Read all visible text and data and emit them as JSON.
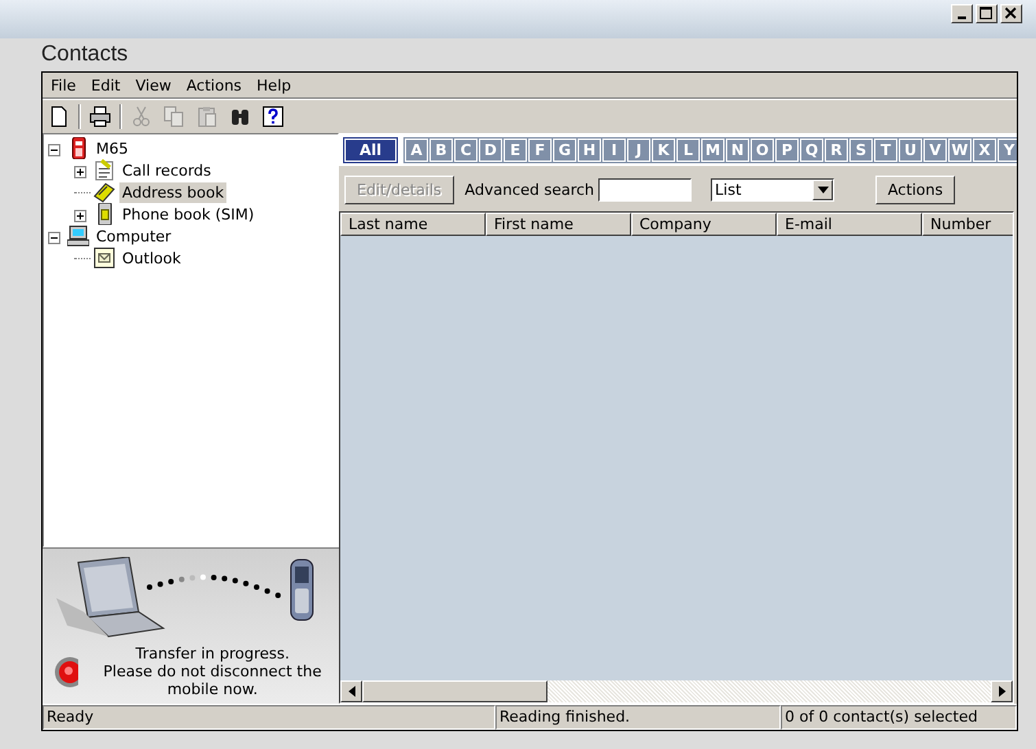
{
  "window": {
    "title": "Contacts"
  },
  "menu": [
    "File",
    "Edit",
    "View",
    "Actions",
    "Help"
  ],
  "toolbar": [
    {
      "kind": "new",
      "disabled": false
    },
    {
      "kind": "print",
      "disabled": false
    },
    {
      "kind": "cut",
      "disabled": true
    },
    {
      "kind": "copy",
      "disabled": true
    },
    {
      "kind": "paste",
      "disabled": true
    },
    {
      "kind": "find",
      "disabled": false
    },
    {
      "kind": "help",
      "disabled": false
    }
  ],
  "tree": [
    {
      "label": "M65",
      "kind": "phone",
      "expanded": true,
      "selected": false,
      "children": [
        {
          "label": "Call records",
          "kind": "calls",
          "expanded": false,
          "selected": false
        },
        {
          "label": "Address book",
          "kind": "address",
          "selected": true
        },
        {
          "label": "Phone book (SIM)",
          "kind": "sim",
          "expanded": false,
          "selected": false
        }
      ]
    },
    {
      "label": "Computer",
      "kind": "computer",
      "expanded": true,
      "selected": false,
      "children": [
        {
          "label": "Outlook",
          "kind": "outlook",
          "selected": false
        }
      ]
    }
  ],
  "transfer": {
    "message": "Transfer in progress.\nPlease do not disconnect the mobile now."
  },
  "letters": [
    {
      "label": "All",
      "selected": true
    },
    {
      "label": "A",
      "selected": false
    },
    {
      "label": "B",
      "selected": false
    },
    {
      "label": "C",
      "selected": false
    },
    {
      "label": "D",
      "selected": false
    },
    {
      "label": "E",
      "selected": false
    },
    {
      "label": "F",
      "selected": false
    },
    {
      "label": "G",
      "selected": false
    },
    {
      "label": "H",
      "selected": false
    },
    {
      "label": "I",
      "selected": false
    },
    {
      "label": "J",
      "selected": false
    },
    {
      "label": "K",
      "selected": false
    },
    {
      "label": "L",
      "selected": false
    },
    {
      "label": "M",
      "selected": false
    },
    {
      "label": "N",
      "selected": false
    },
    {
      "label": "O",
      "selected": false
    },
    {
      "label": "P",
      "selected": false
    },
    {
      "label": "Q",
      "selected": false
    },
    {
      "label": "R",
      "selected": false
    },
    {
      "label": "S",
      "selected": false
    },
    {
      "label": "T",
      "selected": false
    },
    {
      "label": "U",
      "selected": false
    },
    {
      "label": "V",
      "selected": false
    },
    {
      "label": "W",
      "selected": false
    },
    {
      "label": "X",
      "selected": false
    },
    {
      "label": "Y",
      "selected": false
    }
  ],
  "edit_button": {
    "label": "Edit/details",
    "disabled": true
  },
  "search": {
    "label": "Advanced search"
  },
  "view_select": {
    "value": "List"
  },
  "actions_button": {
    "label": "Actions"
  },
  "table": {
    "columns": [
      "Last name",
      "First name",
      "Company",
      "E-mail",
      "Number"
    ]
  },
  "status_bar": [
    "Ready",
    "Reading finished.",
    "0 of 0 contact(s) selected"
  ]
}
